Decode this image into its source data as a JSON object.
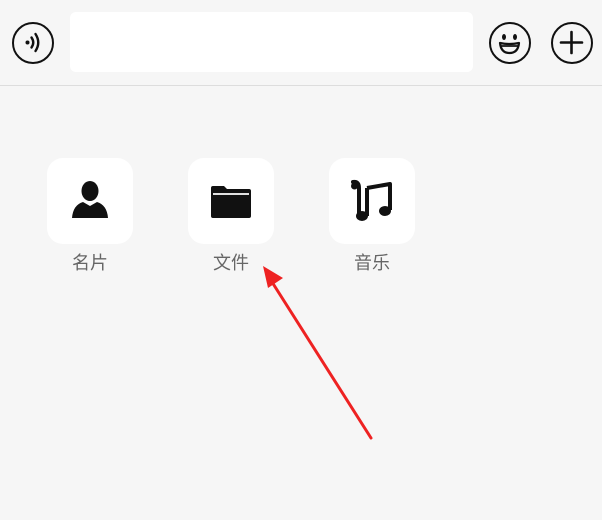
{
  "toolbar": {
    "voice_icon": "voice-icon",
    "input_value": "",
    "input_placeholder": "",
    "emoji_icon": "emoji-icon",
    "plus_icon": "plus-icon"
  },
  "panel": {
    "items": [
      {
        "label": "名片",
        "icon": "contact-card-icon"
      },
      {
        "label": "文件",
        "icon": "folder-icon"
      },
      {
        "label": "音乐",
        "icon": "music-note-icon"
      }
    ]
  },
  "annotation": {
    "arrow_color": "#ee2222",
    "arrow_target": "文件"
  }
}
